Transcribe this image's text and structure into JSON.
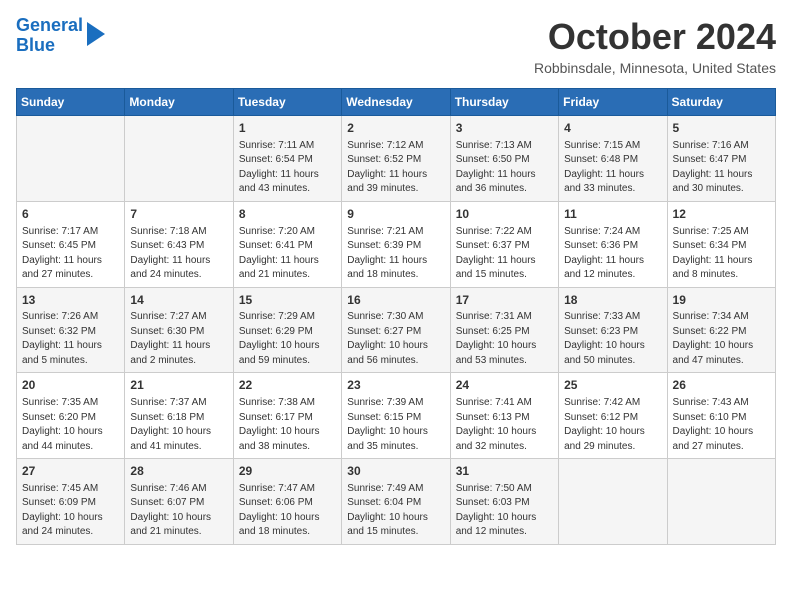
{
  "header": {
    "logo_line1": "General",
    "logo_line2": "Blue",
    "month_title": "October 2024",
    "location": "Robbinsdale, Minnesota, United States"
  },
  "weekdays": [
    "Sunday",
    "Monday",
    "Tuesday",
    "Wednesday",
    "Thursday",
    "Friday",
    "Saturday"
  ],
  "weeks": [
    [
      {
        "day": "",
        "sunrise": "",
        "sunset": "",
        "daylight": ""
      },
      {
        "day": "",
        "sunrise": "",
        "sunset": "",
        "daylight": ""
      },
      {
        "day": "1",
        "sunrise": "Sunrise: 7:11 AM",
        "sunset": "Sunset: 6:54 PM",
        "daylight": "Daylight: 11 hours and 43 minutes."
      },
      {
        "day": "2",
        "sunrise": "Sunrise: 7:12 AM",
        "sunset": "Sunset: 6:52 PM",
        "daylight": "Daylight: 11 hours and 39 minutes."
      },
      {
        "day": "3",
        "sunrise": "Sunrise: 7:13 AM",
        "sunset": "Sunset: 6:50 PM",
        "daylight": "Daylight: 11 hours and 36 minutes."
      },
      {
        "day": "4",
        "sunrise": "Sunrise: 7:15 AM",
        "sunset": "Sunset: 6:48 PM",
        "daylight": "Daylight: 11 hours and 33 minutes."
      },
      {
        "day": "5",
        "sunrise": "Sunrise: 7:16 AM",
        "sunset": "Sunset: 6:47 PM",
        "daylight": "Daylight: 11 hours and 30 minutes."
      }
    ],
    [
      {
        "day": "6",
        "sunrise": "Sunrise: 7:17 AM",
        "sunset": "Sunset: 6:45 PM",
        "daylight": "Daylight: 11 hours and 27 minutes."
      },
      {
        "day": "7",
        "sunrise": "Sunrise: 7:18 AM",
        "sunset": "Sunset: 6:43 PM",
        "daylight": "Daylight: 11 hours and 24 minutes."
      },
      {
        "day": "8",
        "sunrise": "Sunrise: 7:20 AM",
        "sunset": "Sunset: 6:41 PM",
        "daylight": "Daylight: 11 hours and 21 minutes."
      },
      {
        "day": "9",
        "sunrise": "Sunrise: 7:21 AM",
        "sunset": "Sunset: 6:39 PM",
        "daylight": "Daylight: 11 hours and 18 minutes."
      },
      {
        "day": "10",
        "sunrise": "Sunrise: 7:22 AM",
        "sunset": "Sunset: 6:37 PM",
        "daylight": "Daylight: 11 hours and 15 minutes."
      },
      {
        "day": "11",
        "sunrise": "Sunrise: 7:24 AM",
        "sunset": "Sunset: 6:36 PM",
        "daylight": "Daylight: 11 hours and 12 minutes."
      },
      {
        "day": "12",
        "sunrise": "Sunrise: 7:25 AM",
        "sunset": "Sunset: 6:34 PM",
        "daylight": "Daylight: 11 hours and 8 minutes."
      }
    ],
    [
      {
        "day": "13",
        "sunrise": "Sunrise: 7:26 AM",
        "sunset": "Sunset: 6:32 PM",
        "daylight": "Daylight: 11 hours and 5 minutes."
      },
      {
        "day": "14",
        "sunrise": "Sunrise: 7:27 AM",
        "sunset": "Sunset: 6:30 PM",
        "daylight": "Daylight: 11 hours and 2 minutes."
      },
      {
        "day": "15",
        "sunrise": "Sunrise: 7:29 AM",
        "sunset": "Sunset: 6:29 PM",
        "daylight": "Daylight: 10 hours and 59 minutes."
      },
      {
        "day": "16",
        "sunrise": "Sunrise: 7:30 AM",
        "sunset": "Sunset: 6:27 PM",
        "daylight": "Daylight: 10 hours and 56 minutes."
      },
      {
        "day": "17",
        "sunrise": "Sunrise: 7:31 AM",
        "sunset": "Sunset: 6:25 PM",
        "daylight": "Daylight: 10 hours and 53 minutes."
      },
      {
        "day": "18",
        "sunrise": "Sunrise: 7:33 AM",
        "sunset": "Sunset: 6:23 PM",
        "daylight": "Daylight: 10 hours and 50 minutes."
      },
      {
        "day": "19",
        "sunrise": "Sunrise: 7:34 AM",
        "sunset": "Sunset: 6:22 PM",
        "daylight": "Daylight: 10 hours and 47 minutes."
      }
    ],
    [
      {
        "day": "20",
        "sunrise": "Sunrise: 7:35 AM",
        "sunset": "Sunset: 6:20 PM",
        "daylight": "Daylight: 10 hours and 44 minutes."
      },
      {
        "day": "21",
        "sunrise": "Sunrise: 7:37 AM",
        "sunset": "Sunset: 6:18 PM",
        "daylight": "Daylight: 10 hours and 41 minutes."
      },
      {
        "day": "22",
        "sunrise": "Sunrise: 7:38 AM",
        "sunset": "Sunset: 6:17 PM",
        "daylight": "Daylight: 10 hours and 38 minutes."
      },
      {
        "day": "23",
        "sunrise": "Sunrise: 7:39 AM",
        "sunset": "Sunset: 6:15 PM",
        "daylight": "Daylight: 10 hours and 35 minutes."
      },
      {
        "day": "24",
        "sunrise": "Sunrise: 7:41 AM",
        "sunset": "Sunset: 6:13 PM",
        "daylight": "Daylight: 10 hours and 32 minutes."
      },
      {
        "day": "25",
        "sunrise": "Sunrise: 7:42 AM",
        "sunset": "Sunset: 6:12 PM",
        "daylight": "Daylight: 10 hours and 29 minutes."
      },
      {
        "day": "26",
        "sunrise": "Sunrise: 7:43 AM",
        "sunset": "Sunset: 6:10 PM",
        "daylight": "Daylight: 10 hours and 27 minutes."
      }
    ],
    [
      {
        "day": "27",
        "sunrise": "Sunrise: 7:45 AM",
        "sunset": "Sunset: 6:09 PM",
        "daylight": "Daylight: 10 hours and 24 minutes."
      },
      {
        "day": "28",
        "sunrise": "Sunrise: 7:46 AM",
        "sunset": "Sunset: 6:07 PM",
        "daylight": "Daylight: 10 hours and 21 minutes."
      },
      {
        "day": "29",
        "sunrise": "Sunrise: 7:47 AM",
        "sunset": "Sunset: 6:06 PM",
        "daylight": "Daylight: 10 hours and 18 minutes."
      },
      {
        "day": "30",
        "sunrise": "Sunrise: 7:49 AM",
        "sunset": "Sunset: 6:04 PM",
        "daylight": "Daylight: 10 hours and 15 minutes."
      },
      {
        "day": "31",
        "sunrise": "Sunrise: 7:50 AM",
        "sunset": "Sunset: 6:03 PM",
        "daylight": "Daylight: 10 hours and 12 minutes."
      },
      {
        "day": "",
        "sunrise": "",
        "sunset": "",
        "daylight": ""
      },
      {
        "day": "",
        "sunrise": "",
        "sunset": "",
        "daylight": ""
      }
    ]
  ]
}
